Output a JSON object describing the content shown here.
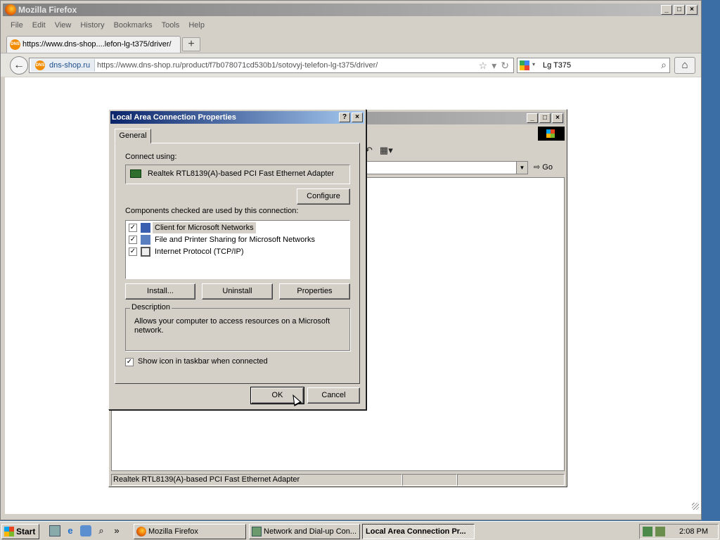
{
  "firefox": {
    "title": "Mozilla Firefox",
    "menu": [
      "File",
      "Edit",
      "View",
      "History",
      "Bookmarks",
      "Tools",
      "Help"
    ],
    "tab_title": "https://www.dns-shop....lefon-lg-t375/driver/",
    "new_tab": "+",
    "site_identity": "dns-shop.ru",
    "url": "https://www.dns-shop.ru/product/f7b078071cd530b1/sotovyj-telefon-lg-t375/driver/",
    "search_query": "Lg T375",
    "favicon_text": "DNS",
    "icons": [
      "firefox-icon",
      "back-arrow-icon",
      "star-icon",
      "dropdown-icon",
      "reload-icon",
      "google-icon",
      "search-icon",
      "home-icon"
    ]
  },
  "net_window": {
    "go_label": "Go",
    "status_text": "Realtek RTL8139(A)-based PCI Fast Ethernet Adapter"
  },
  "dialog": {
    "title": "Local Area Connection Properties",
    "help": "?",
    "close": "×",
    "tab": "General",
    "connect_using_label": "Connect using:",
    "adapter": "Realtek RTL8139(A)-based PCI Fast Ethernet Adapter",
    "configure": "Configure",
    "components_label": "Components checked are used by this connection:",
    "components": [
      {
        "label": "Client for Microsoft Networks",
        "checked": true,
        "selected": true
      },
      {
        "label": "File and Printer Sharing for Microsoft Networks",
        "checked": true,
        "selected": false
      },
      {
        "label": "Internet Protocol (TCP/IP)",
        "checked": true,
        "selected": false
      }
    ],
    "install": "Install...",
    "uninstall": "Uninstall",
    "properties": "Properties",
    "description_legend": "Description",
    "description": "Allows your computer to access resources on a Microsoft network.",
    "show_icon_label": "Show icon in taskbar when connected",
    "show_icon_checked": true,
    "ok": "OK",
    "cancel": "Cancel"
  },
  "taskbar": {
    "start": "Start",
    "chevron": "»",
    "tasks": [
      "Mozilla Firefox",
      "Network and Dial-up Con...",
      "Local Area Connection Pr..."
    ],
    "clock": "2:08 PM"
  }
}
